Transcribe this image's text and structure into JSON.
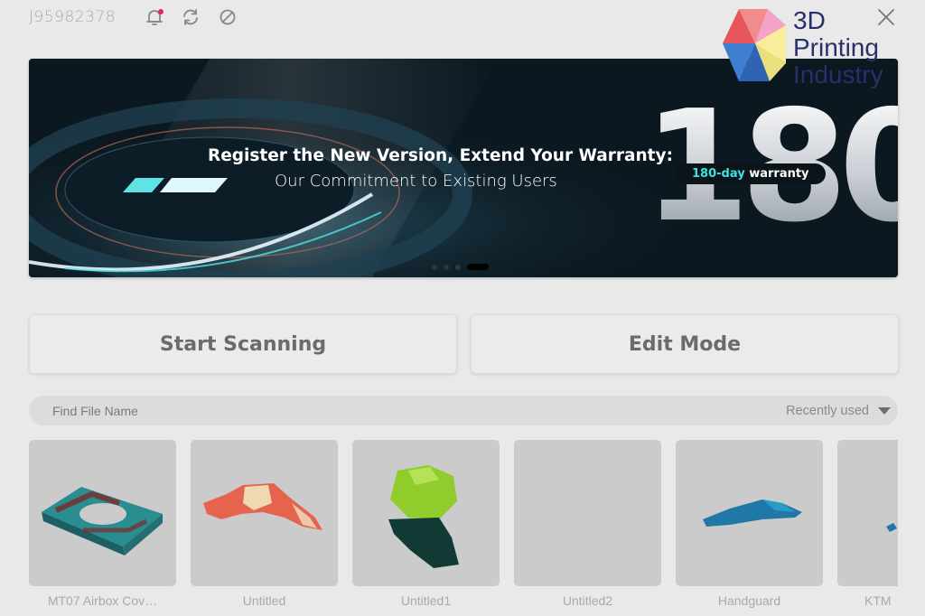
{
  "topbar": {
    "device_id": "J95982378",
    "icons": [
      "bell-icon",
      "sync-icon",
      "clean-icon",
      "close-icon"
    ],
    "notification_dot_color": "#e6246b"
  },
  "watermark": {
    "line1": "3D",
    "line2": "Printing",
    "line3": "Industry"
  },
  "banner": {
    "title": "Register the New Version, Extend Your Warranty:",
    "subtitle": "Our Commitment to Existing Users",
    "big_number": "180",
    "pill_accent": "180-day",
    "pill_rest": " warranty",
    "slide_count": 4,
    "active_slide": 4,
    "accent_color": "#3fe0df"
  },
  "actions": {
    "start_scanning": "Start Scanning",
    "edit_mode": "Edit Mode"
  },
  "search": {
    "placeholder": "Find File Name",
    "sort_value": "Recently used"
  },
  "files": [
    {
      "name": "MT07 Airbox Cov…"
    },
    {
      "name": "Untitled"
    },
    {
      "name": "Untitled1"
    },
    {
      "name": "Untitled2"
    },
    {
      "name": "Handguard"
    },
    {
      "name": "KTM"
    }
  ]
}
